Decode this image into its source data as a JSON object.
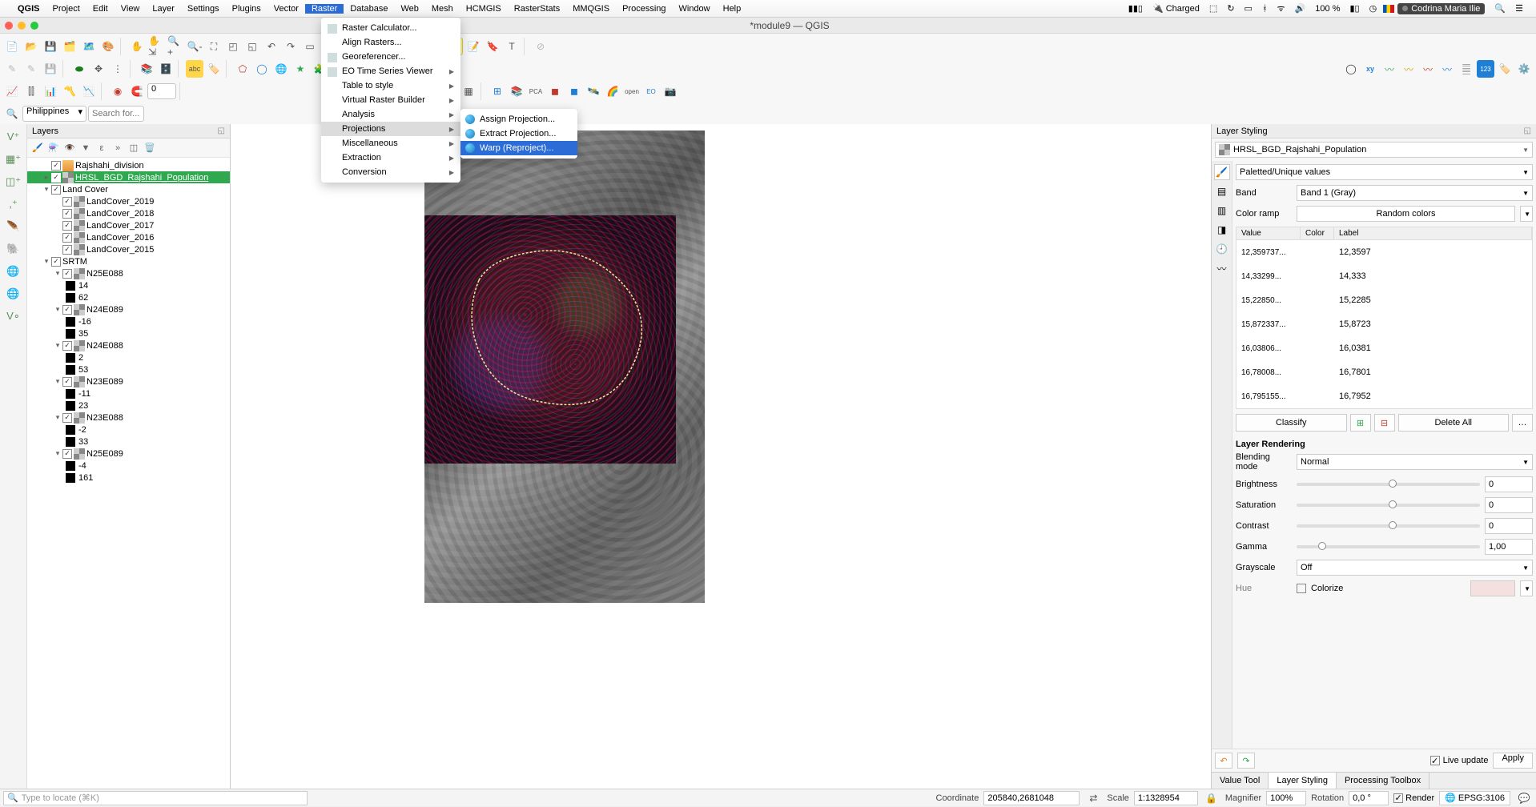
{
  "mac_menubar": {
    "app": "QGIS",
    "items": [
      "Project",
      "Edit",
      "View",
      "Layer",
      "Settings",
      "Plugins",
      "Vector",
      "Raster",
      "Database",
      "Web",
      "Mesh",
      "HCMGIS",
      "RasterStats",
      "MMQGIS",
      "Processing",
      "Window",
      "Help"
    ],
    "active_index": 7,
    "status": {
      "charged": "Charged",
      "battery_pct": "100 %",
      "user": "Codrina Maria Ilie"
    }
  },
  "window": {
    "title": "*module9 — QGIS"
  },
  "raster_menu": {
    "items": [
      {
        "label": "Raster Calculator...",
        "icon": true
      },
      {
        "label": "Align Rasters...",
        "icon": false
      },
      {
        "label": "Georeferencer...",
        "icon": true
      },
      {
        "label": "EO Time Series Viewer",
        "icon": true,
        "submenu": true
      },
      {
        "label": "Table to style",
        "icon": false,
        "submenu": true
      },
      {
        "label": "Virtual Raster Builder",
        "icon": false,
        "submenu": true
      },
      {
        "label": "Analysis",
        "icon": false,
        "submenu": true
      },
      {
        "label": "Projections",
        "icon": false,
        "submenu": true,
        "highlight": true
      },
      {
        "label": "Miscellaneous",
        "icon": false,
        "submenu": true
      },
      {
        "label": "Extraction",
        "icon": false,
        "submenu": true
      },
      {
        "label": "Conversion",
        "icon": false,
        "submenu": true
      }
    ]
  },
  "projections_submenu": {
    "items": [
      {
        "label": "Assign Projection..."
      },
      {
        "label": "Extract Projection..."
      },
      {
        "label": "Warp (Reproject)...",
        "highlight": true
      }
    ]
  },
  "layers_panel": {
    "title": "Layers",
    "tree": [
      {
        "type": "layer",
        "name": "Rajshahi_division",
        "checked": true,
        "icon": "vector",
        "indent": 1
      },
      {
        "type": "layer",
        "name": "HRSL_BGD_Rajshahi_Population",
        "checked": true,
        "icon": "raster",
        "indent": 1,
        "selected": true,
        "expandable": true
      },
      {
        "type": "group",
        "name": "Land Cover",
        "checked": true,
        "indent": 1,
        "children": [
          {
            "type": "layer",
            "name": "LandCover_2019",
            "checked": true,
            "icon": "raster"
          },
          {
            "type": "layer",
            "name": "LandCover_2018",
            "checked": true,
            "icon": "raster"
          },
          {
            "type": "layer",
            "name": "LandCover_2017",
            "checked": true,
            "icon": "raster"
          },
          {
            "type": "layer",
            "name": "LandCover_2016",
            "checked": true,
            "icon": "raster"
          },
          {
            "type": "layer",
            "name": "LandCover_2015",
            "checked": true,
            "icon": "raster"
          }
        ]
      },
      {
        "type": "group",
        "name": "SRTM",
        "checked": true,
        "indent": 1,
        "children": [
          {
            "type": "layer",
            "name": "N25E088",
            "checked": true,
            "icon": "raster",
            "stats": [
              "14",
              "62"
            ]
          },
          {
            "type": "layer",
            "name": "N24E089",
            "checked": true,
            "icon": "raster",
            "stats": [
              "-16",
              "35"
            ]
          },
          {
            "type": "layer",
            "name": "N24E088",
            "checked": true,
            "icon": "raster",
            "stats": [
              "2",
              "53"
            ]
          },
          {
            "type": "layer",
            "name": "N23E089",
            "checked": true,
            "icon": "raster",
            "stats": [
              "-11",
              "23"
            ]
          },
          {
            "type": "layer",
            "name": "N23E088",
            "checked": true,
            "icon": "raster",
            "stats": [
              "-2",
              "33"
            ]
          },
          {
            "type": "layer",
            "name": "N25E089",
            "checked": true,
            "icon": "raster",
            "stats": [
              "-4",
              "161"
            ]
          }
        ]
      }
    ]
  },
  "locator_search": {
    "placeholder": "Search for...",
    "crs_search": "Philippines"
  },
  "styling_panel": {
    "title": "Layer Styling",
    "layer": "HRSL_BGD_Rajshahi_Population",
    "render_type": "Paletted/Unique values",
    "band": {
      "label": "Band",
      "value": "Band 1 (Gray)"
    },
    "ramp": {
      "label": "Color ramp",
      "value": "Random colors"
    },
    "table": {
      "headers": {
        "value": "Value",
        "color": "Color",
        "label": "Label"
      },
      "rows": [
        {
          "value": "12,359737...",
          "color": "#1dcf63",
          "label": "12,3597"
        },
        {
          "value": "14,33299...",
          "color": "#8fbc29",
          "label": "14,333"
        },
        {
          "value": "15,22850...",
          "color": "#3b74e3",
          "label": "15,2285"
        },
        {
          "value": "15,872337...",
          "color": "#1fd84c",
          "label": "15,8723"
        },
        {
          "value": "16,03806...",
          "color": "#d22ec0",
          "label": "16,0381"
        },
        {
          "value": "16,78008...",
          "color": "#a362ec",
          "label": "16,7801"
        },
        {
          "value": "16,795155...",
          "color": "#d85a3c",
          "label": "16,7952"
        }
      ]
    },
    "buttons": {
      "classify": "Classify",
      "delete_all": "Delete All"
    },
    "rendering": {
      "title": "Layer Rendering",
      "blending": {
        "label": "Blending mode",
        "value": "Normal"
      },
      "brightness": {
        "label": "Brightness",
        "value": "0"
      },
      "saturation": {
        "label": "Saturation",
        "value": "0"
      },
      "contrast": {
        "label": "Contrast",
        "value": "0"
      },
      "gamma": {
        "label": "Gamma",
        "value": "1,00"
      },
      "grayscale": {
        "label": "Grayscale",
        "value": "Off"
      },
      "colorize": {
        "label": "Colorize"
      }
    },
    "footer": {
      "live": "Live update",
      "apply": "Apply"
    },
    "bottom_tabs": [
      "Value Tool",
      "Layer Styling",
      "Processing Toolbox"
    ],
    "bottom_tabs_active": 1
  },
  "status_bar": {
    "locator_placeholder": "Type to locate (⌘K)",
    "coordinate": {
      "label": "Coordinate",
      "value": "205840,2681048"
    },
    "scale": {
      "label": "Scale",
      "value": "1:1328954"
    },
    "magnifier": {
      "label": "Magnifier",
      "value": "100%"
    },
    "rotation": {
      "label": "Rotation",
      "value": "0,0 °"
    },
    "render": {
      "label": "Render",
      "checked": true
    },
    "crs": "EPSG:3106"
  }
}
